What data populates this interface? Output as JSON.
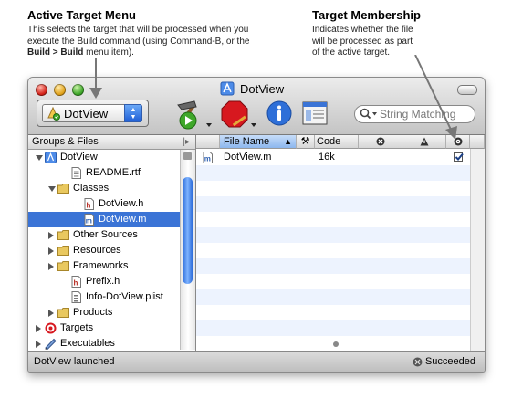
{
  "annotations": {
    "left_title": "Active Target Menu",
    "left_line1": "This selects the target that will be processed when you",
    "left_line2": "execute the Build command (using Command-B, or the",
    "left_line3_bold1": "Build > Build",
    "left_line3_rest": " menu item).",
    "right_title": "Target Membership",
    "right_line1": "Indicates whether the file",
    "right_line2": "will be processed as part",
    "right_line3": "of the active target."
  },
  "window": {
    "title": "DotView",
    "active_target": "DotView",
    "search_placeholder": "String Matching"
  },
  "sidebar": {
    "header": "Groups & Files",
    "items": [
      {
        "label": "DotView",
        "icon": "project-icon",
        "indent": 0,
        "disclosure": "open"
      },
      {
        "label": "README.rtf",
        "icon": "rtf-file-icon",
        "indent": 2,
        "disclosure": "none"
      },
      {
        "label": "Classes",
        "icon": "folder-icon",
        "indent": 1,
        "disclosure": "open"
      },
      {
        "label": "DotView.h",
        "icon": "header-file-icon",
        "indent": 3,
        "disclosure": "none"
      },
      {
        "label": "DotView.m",
        "icon": "source-file-icon",
        "indent": 3,
        "disclosure": "none",
        "selected": true
      },
      {
        "label": "Other Sources",
        "icon": "folder-icon",
        "indent": 1,
        "disclosure": "closed"
      },
      {
        "label": "Resources",
        "icon": "folder-icon",
        "indent": 1,
        "disclosure": "closed"
      },
      {
        "label": "Frameworks",
        "icon": "folder-icon",
        "indent": 1,
        "disclosure": "closed"
      },
      {
        "label": "Prefix.h",
        "icon": "header-file-icon",
        "indent": 2,
        "disclosure": "none"
      },
      {
        "label": "Info-DotView.plist",
        "icon": "plist-file-icon",
        "indent": 2,
        "disclosure": "none"
      },
      {
        "label": "Products",
        "icon": "folder-icon",
        "indent": 1,
        "disclosure": "closed"
      },
      {
        "label": "Targets",
        "icon": "target-icon",
        "indent": 0,
        "disclosure": "closed"
      },
      {
        "label": "Executables",
        "icon": "executable-icon",
        "indent": 0,
        "disclosure": "closed"
      }
    ]
  },
  "detail": {
    "columns": {
      "file_name": "File Name",
      "code": "Code"
    },
    "rows": [
      {
        "file_name": "DotView.m",
        "code": "16k",
        "in_target": true
      }
    ]
  },
  "status": {
    "left": "DotView launched",
    "right": "Succeeded"
  },
  "colors": {
    "selection": "#3b74d6",
    "alt_row": "#edf3fe"
  }
}
